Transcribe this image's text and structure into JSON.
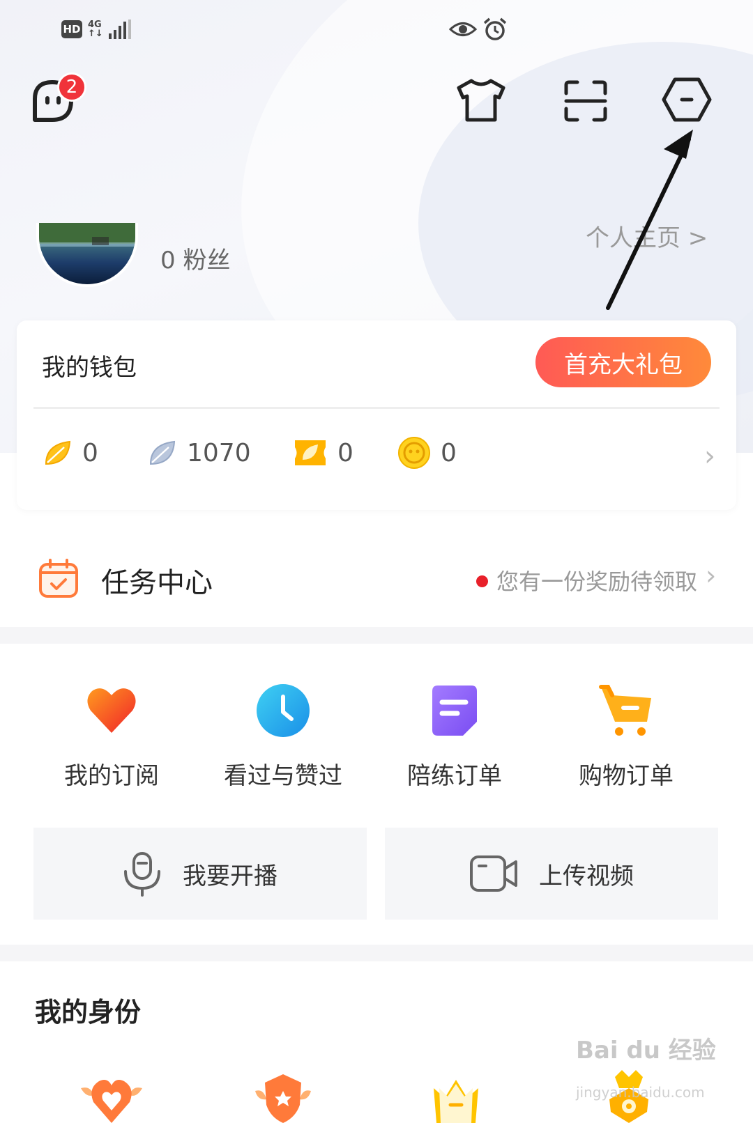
{
  "status_bar": {
    "hd": "HD",
    "network_top": "4G",
    "network_bottom": "↑↓"
  },
  "header": {
    "message_badge_count": "2",
    "icons": [
      "message-icon",
      "tshirt-icon",
      "scan-icon",
      "settings-hexagon-icon"
    ]
  },
  "profile": {
    "fans": "0 粉丝",
    "homepage_link": "个人主页 >"
  },
  "wallet": {
    "title": "我的钱包",
    "gift_button": "首充大礼包",
    "items": [
      {
        "icon": "gold-leaf-icon",
        "value": "0"
      },
      {
        "icon": "silver-leaf-icon",
        "value": "1070"
      },
      {
        "icon": "leaf-ticket-icon",
        "value": "0"
      },
      {
        "icon": "coin-icon",
        "value": "0"
      }
    ]
  },
  "task_center": {
    "title": "任务中心",
    "hint": "您有一份奖励待领取"
  },
  "quick_grid": [
    {
      "label": "我的订阅",
      "icon": "heart-icon"
    },
    {
      "label": "看过与赞过",
      "icon": "clock-icon"
    },
    {
      "label": "陪练订单",
      "icon": "note-icon"
    },
    {
      "label": "购物订单",
      "icon": "cart-icon"
    }
  ],
  "actions": {
    "live_label": "我要开播",
    "upload_label": "上传视频"
  },
  "identity": {
    "title": "我的身份"
  },
  "watermark": {
    "line1": "Bai du 经验",
    "line2": "jingyan.baidu.com"
  },
  "colors": {
    "accent_gradient_start": "#ff5a55",
    "accent_gradient_end": "#ff8a3a",
    "badge_red": "#f0333a",
    "orange": "#ff8a3a"
  }
}
